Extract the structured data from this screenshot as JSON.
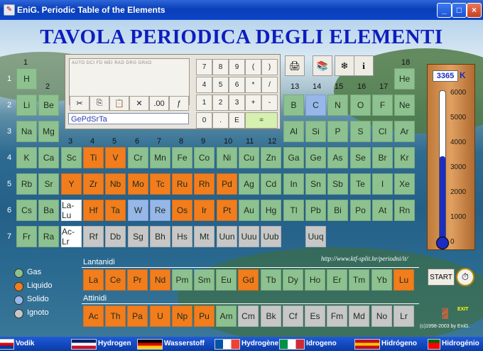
{
  "window": {
    "title": "EniG. Periodic Table of the Elements",
    "min": "_",
    "max": "□",
    "close": "×"
  },
  "main_title": "TAVOLA PERIODICA DEGLI ELEMENTI",
  "calculator": {
    "modes": "AUTO  DCI  FD    MEI    RAD  DRG  GRAD",
    "input_value": "GePdSrTa",
    "keys": [
      [
        "7",
        "8",
        "9",
        "(",
        ")"
      ],
      [
        "4",
        "5",
        "6",
        "*",
        "/"
      ],
      [
        "1",
        "2",
        "3",
        "+",
        "-"
      ],
      [
        "0",
        ".",
        "E",
        "="
      ]
    ],
    "tools": [
      "✂",
      "⎘",
      "📋",
      "✕",
      ".00",
      "ƒ"
    ]
  },
  "thermometer": {
    "value": "3365",
    "unit": "K",
    "ticks": [
      "6000",
      "5000",
      "4000",
      "3000",
      "2000",
      "1000",
      "0"
    ],
    "level_fraction": 0.56
  },
  "url": "http://www.ktf-split.hr/periodni/it/",
  "sections": {
    "lanthanides": "Lantanidi",
    "actinides": "Attinidi"
  },
  "legend": [
    {
      "label": "Gas",
      "color": "#8dc18f"
    },
    {
      "label": "Liquido",
      "color": "#f27d1c"
    },
    {
      "label": "Solido",
      "color": "#96b7e8"
    },
    {
      "label": "Ignoto",
      "color": "#c7c7c7"
    }
  ],
  "start_label": "START",
  "exit_label": "EXIT",
  "copyright": "(c)1998-2003 by EniG.",
  "groups": [
    "1",
    "2",
    "3",
    "4",
    "5",
    "6",
    "7",
    "8",
    "9",
    "10",
    "11",
    "12",
    "13",
    "14",
    "15",
    "16",
    "17",
    "18"
  ],
  "periods": [
    "1",
    "2",
    "3",
    "4",
    "5",
    "6",
    "7"
  ],
  "rows": [
    [
      [
        "H",
        "g"
      ],
      null,
      null,
      null,
      null,
      null,
      null,
      null,
      null,
      null,
      null,
      null,
      null,
      null,
      null,
      null,
      null,
      [
        "He",
        "g"
      ]
    ],
    [
      [
        "Li",
        "g"
      ],
      [
        "Be",
        "g"
      ],
      null,
      null,
      null,
      null,
      null,
      null,
      null,
      null,
      null,
      null,
      [
        "B",
        "g"
      ],
      [
        "C",
        "s"
      ],
      [
        "N",
        "g"
      ],
      [
        "O",
        "g"
      ],
      [
        "F",
        "g"
      ],
      [
        "Ne",
        "g"
      ]
    ],
    [
      [
        "Na",
        "g"
      ],
      [
        "Mg",
        "g"
      ],
      null,
      null,
      null,
      null,
      null,
      null,
      null,
      null,
      null,
      null,
      [
        "Al",
        "g"
      ],
      [
        "Si",
        "g"
      ],
      [
        "P",
        "g"
      ],
      [
        "S",
        "g"
      ],
      [
        "Cl",
        "g"
      ],
      [
        "Ar",
        "g"
      ]
    ],
    [
      [
        "K",
        "g"
      ],
      [
        "Ca",
        "g"
      ],
      [
        "Sc",
        "g"
      ],
      [
        "Ti",
        "l"
      ],
      [
        "V",
        "l"
      ],
      [
        "Cr",
        "g"
      ],
      [
        "Mn",
        "g"
      ],
      [
        "Fe",
        "g"
      ],
      [
        "Co",
        "g"
      ],
      [
        "Ni",
        "g"
      ],
      [
        "Cu",
        "g"
      ],
      [
        "Zn",
        "g"
      ],
      [
        "Ga",
        "g"
      ],
      [
        "Ge",
        "g"
      ],
      [
        "As",
        "g"
      ],
      [
        "Se",
        "g"
      ],
      [
        "Br",
        "g"
      ],
      [
        "Kr",
        "g"
      ]
    ],
    [
      [
        "Rb",
        "g"
      ],
      [
        "Sr",
        "g"
      ],
      [
        "Y",
        "l"
      ],
      [
        "Zr",
        "l"
      ],
      [
        "Nb",
        "l"
      ],
      [
        "Mo",
        "l"
      ],
      [
        "Tc",
        "l"
      ],
      [
        "Ru",
        "l"
      ],
      [
        "Rh",
        "l"
      ],
      [
        "Pd",
        "l"
      ],
      [
        "Ag",
        "g"
      ],
      [
        "Cd",
        "g"
      ],
      [
        "In",
        "g"
      ],
      [
        "Sn",
        "g"
      ],
      [
        "Sb",
        "g"
      ],
      [
        "Te",
        "g"
      ],
      [
        "I",
        "g"
      ],
      [
        "Xe",
        "g"
      ]
    ],
    [
      [
        "Cs",
        "g"
      ],
      [
        "Ba",
        "g"
      ],
      [
        "La-Lu",
        "w"
      ],
      [
        "Hf",
        "l"
      ],
      [
        "Ta",
        "l"
      ],
      [
        "W",
        "s"
      ],
      [
        "Re",
        "s"
      ],
      [
        "Os",
        "l"
      ],
      [
        "Ir",
        "l"
      ],
      [
        "Pt",
        "l"
      ],
      [
        "Au",
        "g"
      ],
      [
        "Hg",
        "g"
      ],
      [
        "Tl",
        "g"
      ],
      [
        "Pb",
        "g"
      ],
      [
        "Bi",
        "g"
      ],
      [
        "Po",
        "g"
      ],
      [
        "At",
        "g"
      ],
      [
        "Rn",
        "g"
      ]
    ],
    [
      [
        "Fr",
        "g"
      ],
      [
        "Ra",
        "g"
      ],
      [
        "Ac-Lr",
        "w"
      ],
      [
        "Rf",
        "u"
      ],
      [
        "Db",
        "u"
      ],
      [
        "Sg",
        "u"
      ],
      [
        "Bh",
        "u"
      ],
      [
        "Hs",
        "u"
      ],
      [
        "Mt",
        "u"
      ],
      [
        "Uun",
        "u"
      ],
      [
        "Uuu",
        "u"
      ],
      [
        "Uub",
        "u"
      ],
      null,
      [
        "Uuq",
        "u"
      ],
      null,
      null,
      null,
      null
    ]
  ],
  "lanthanides": [
    [
      "La",
      "l"
    ],
    [
      "Ce",
      "l"
    ],
    [
      "Pr",
      "l"
    ],
    [
      "Nd",
      "l"
    ],
    [
      "Pm",
      "g"
    ],
    [
      "Sm",
      "g"
    ],
    [
      "Eu",
      "g"
    ],
    [
      "Gd",
      "l"
    ],
    [
      "Tb",
      "g"
    ],
    [
      "Dy",
      "g"
    ],
    [
      "Ho",
      "g"
    ],
    [
      "Er",
      "g"
    ],
    [
      "Tm",
      "g"
    ],
    [
      "Yb",
      "g"
    ],
    [
      "Lu",
      "l"
    ]
  ],
  "actinides": [
    [
      "Ac",
      "l"
    ],
    [
      "Th",
      "l"
    ],
    [
      "Pa",
      "l"
    ],
    [
      "U",
      "l"
    ],
    [
      "Np",
      "l"
    ],
    [
      "Pu",
      "l"
    ],
    [
      "Am",
      "g"
    ],
    [
      "Cm",
      "u"
    ],
    [
      "Bk",
      "u"
    ],
    [
      "Cf",
      "u"
    ],
    [
      "Es",
      "u"
    ],
    [
      "Fm",
      "u"
    ],
    [
      "Md",
      "u"
    ],
    [
      "No",
      "u"
    ],
    [
      "Lr",
      "u"
    ]
  ],
  "languages": [
    "Vodik",
    "Hydrogen",
    "Wasserstoff",
    "Hydrogène",
    "Idrogeno",
    "Hidrógeno",
    "Hidrogénio"
  ]
}
